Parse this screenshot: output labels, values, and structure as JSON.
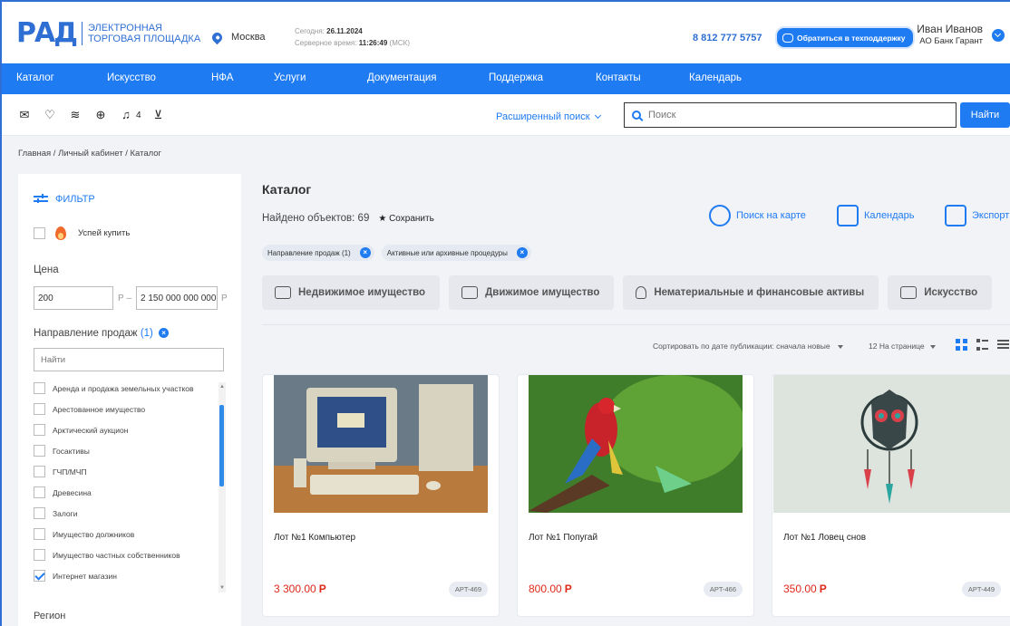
{
  "header": {
    "logo_mark": "РАД",
    "logo_line1": "ЭЛЕКТРОННАЯ",
    "logo_line2": "ТОРГОВАЯ ПЛОЩАДКА",
    "city": "Москва",
    "today_label": "Сегодня:",
    "today_value": "26.11.2024",
    "server_label": "Серверное время:",
    "server_value": "11:26:49",
    "server_tz": "(МСК)",
    "phone": "8 812 777 5757",
    "support_label": "Обратиться в техподдержку",
    "user_name": "Иван Иванов",
    "user_org": "АО Банк Гарант"
  },
  "nav": {
    "items": [
      "Каталог",
      "Искусство",
      "НФА",
      "Услуги",
      "Документация",
      "Поддержка",
      "Контакты",
      "Календарь"
    ]
  },
  "toolbar": {
    "icons": [
      "mail-icon",
      "heart-icon",
      "layers-icon",
      "zoom-icon",
      "bell-icon",
      "cart-icon"
    ],
    "bell_count": "4",
    "advanced_search": "Расширенный поиск",
    "search_placeholder": "Поиск",
    "search_button": "Найти"
  },
  "breadcrumb": "Главная / Личный кабинет / Каталог",
  "filter": {
    "title": "ФИЛЬТР",
    "hurry_label": "Успей купить",
    "price_label": "Цена",
    "price_from": "200",
    "price_to": "2 150 000 000 000",
    "currency": "Р",
    "price_dash": "Р  –",
    "direction_label": "Направление продаж",
    "direction_count": "(1)",
    "direction_search_placeholder": "Найти",
    "directions": [
      {
        "label": "Аренда и продажа земельных участков",
        "checked": false
      },
      {
        "label": "Арестованное имущество",
        "checked": false
      },
      {
        "label": "Арктический аукцион",
        "checked": false
      },
      {
        "label": "Госактивы",
        "checked": false
      },
      {
        "label": "ГЧП/МЧП",
        "checked": false
      },
      {
        "label": "Древесина",
        "checked": false
      },
      {
        "label": "Залоги",
        "checked": false
      },
      {
        "label": "Имущество должников",
        "checked": false
      },
      {
        "label": "Имущество частных собственников",
        "checked": false
      },
      {
        "label": "Интернет магазин",
        "checked": true
      }
    ],
    "region_label": "Регион"
  },
  "main": {
    "title": "Каталог",
    "found_label": "Найдено объектов: 69",
    "save_label": "★ Сохранить",
    "actions": [
      "Поиск на карте",
      "Календарь",
      "Экспорт"
    ],
    "chips": [
      "Направление продаж (1)",
      "Активные или архивные процедуры"
    ],
    "categories": [
      "Недвижимое имущество",
      "Движимое имущество",
      "Нематериальные и финансовые активы",
      "Искусство"
    ],
    "sort_label": "Сортировать по дате публикации: сначала новые",
    "per_page_label": "12 На странице",
    "cards": [
      {
        "name": "Лот №1 Компьютер",
        "price": "3 300.00",
        "currency": "Р",
        "art": "APT-469"
      },
      {
        "name": "Лот №1 Попугай",
        "price": "800.00",
        "currency": "Р",
        "art": "APT-466"
      },
      {
        "name": "Лот №1 Ловец снов",
        "price": "350.00",
        "currency": "Р",
        "art": "APT-449"
      }
    ]
  },
  "colors": {
    "accent": "#1f7bf2",
    "price": "#e0271a",
    "background": "#f1f3f7"
  }
}
